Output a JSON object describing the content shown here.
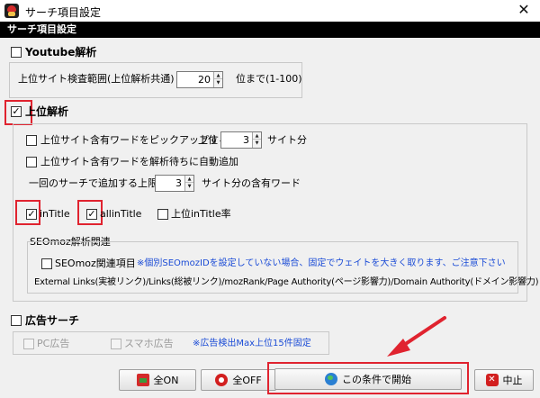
{
  "window": {
    "title": "サーチ項目設定",
    "close_glyph": "✕"
  },
  "section_bar": {
    "title": "サーチ項目設定"
  },
  "youtube": {
    "checkbox_label": "Youtube解析",
    "checked": false,
    "range_label": "上位サイト検査範囲(上位解析共通)",
    "range_value": "20",
    "range_suffix": "位まで(1-100)"
  },
  "top_analysis": {
    "checkbox_label": "上位解析",
    "checked": true,
    "pickup_label": "上位サイト含有ワードをピックアップする",
    "pickup_checked": false,
    "pickup_prefix": "上位",
    "pickup_value": "3",
    "pickup_suffix": "サイト分",
    "autoadd_label": "上位サイト含有ワードを解析待ちに自動追加",
    "autoadd_checked": false,
    "limit_label": "一回のサーチで追加する上限",
    "limit_value": "3",
    "limit_suffix": "サイト分の含有ワード",
    "intitle_label": "inTitle",
    "intitle_checked": true,
    "allintitle_label": "allinTitle",
    "allintitle_checked": true,
    "intitle_rate_label": "上位inTitle率",
    "intitle_rate_checked": false,
    "seomoz": {
      "group_label": "SEOmoz解析関連",
      "item_label": "SEOmoz関連項目",
      "item_checked": false,
      "note": "※個別SEOmozIDを設定していない場合、固定でウェイトを大きく取ります、ご注意下さい",
      "links_text": "External Links(実被リンク)/Links(総被リンク)/mozRank/Page Authority(ページ影響力)/Domain Authority(ドメイン影響力)"
    }
  },
  "ads": {
    "checkbox_label": "広告サーチ",
    "checked": false,
    "pc_label": "PC広告",
    "smartphone_label": "スマホ広告",
    "note": "※広告検出Max上位15件固定"
  },
  "buttons": {
    "all_on": "全ON",
    "all_off": "全OFF",
    "start": "この条件で開始",
    "stop": "中止"
  },
  "check_glyph": "✓",
  "colors": {
    "highlight_red": "#e0232f",
    "note_blue": "#1a4bd6",
    "section_bar": "#000000"
  }
}
